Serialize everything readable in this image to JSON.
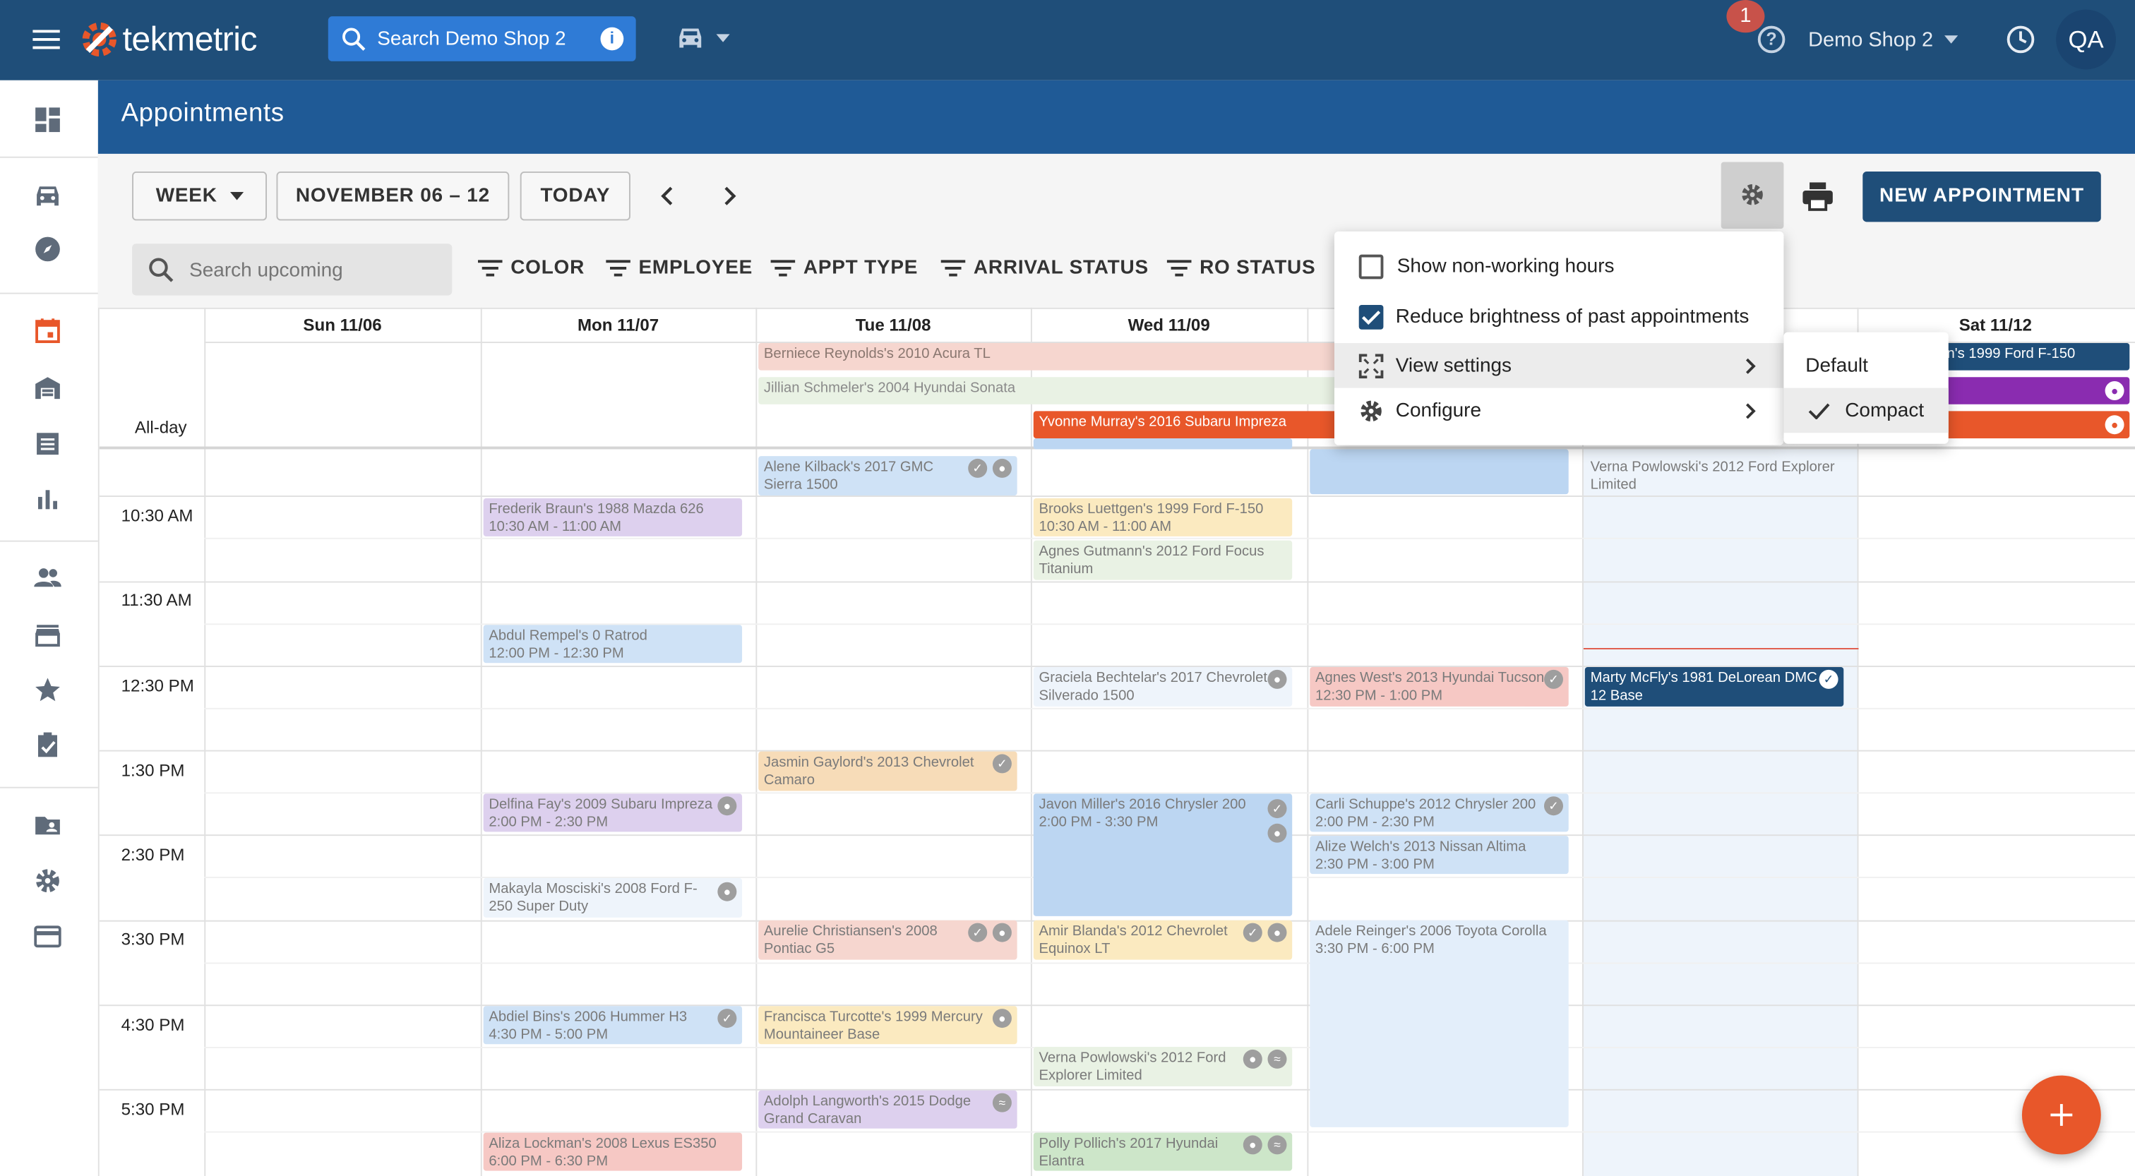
{
  "topbar": {
    "logo_text": "tekmetric",
    "search_label": "Search Demo Shop 2",
    "shop_name": "Demo Shop 2",
    "notification_count": "1",
    "user_initials": "QA"
  },
  "page": {
    "title": "Appointments"
  },
  "toolbar": {
    "view_label": "WEEK",
    "date_range": "NOVEMBER 06 – 12",
    "today_label": "TODAY",
    "new_appt_label": "NEW APPOINTMENT",
    "search_placeholder": "Search upcoming",
    "filters": [
      "COLOR",
      "EMPLOYEE",
      "APPT TYPE",
      "ARRIVAL STATUS",
      "RO STATUS"
    ]
  },
  "calendar": {
    "days": [
      "Sun 11/06",
      "Mon 11/07",
      "Tue 11/08",
      "Wed 11/09",
      "",
      "",
      "Sat 11/12"
    ],
    "allday_label": "All-day",
    "times": [
      "10:30 AM",
      "11:30 AM",
      "12:30 PM",
      "1:30 PM",
      "2:30 PM",
      "3:30 PM",
      "4:30 PM",
      "5:30 PM"
    ],
    "allday_events": {
      "e1": "Berniece Reynolds's 2010 Acura TL",
      "e2": "Jillian Schmeler's 2004 Hyundai Sonata",
      "e3": "Yvonne Murray's 2016 Subaru Impreza",
      "e4": "en's 1999 Ford F-150"
    },
    "events": {
      "alene": {
        "l1": "Alene Kilback's 2017 GMC",
        "l2": "Sierra 1500"
      },
      "verna_top": {
        "l1": "Verna Powlowski's 2012 Ford Explorer",
        "l2": "Limited"
      },
      "frederik": {
        "l1": "Frederik Braun's 1988 Mazda 626",
        "l2": "10:30 AM - 11:00 AM"
      },
      "brooks": {
        "l1": "Brooks Luettgen's 1999 Ford F-150",
        "l2": "10:30 AM - 11:00 AM"
      },
      "agnes_g": {
        "l1": "Agnes Gutmann's 2012 Ford Focus",
        "l2": "Titanium"
      },
      "abdul": {
        "l1": "Abdul Rempel's 0 Ratrod",
        "l2": "12:00 PM - 12:30 PM"
      },
      "graciela": {
        "l1": "Graciela Bechtelar's 2017 Chevrolet",
        "l2": "Silverado 1500"
      },
      "agnes_w": {
        "l1": "Agnes West's 2013 Hyundai Tucson",
        "l2": "12:30 PM - 1:00 PM"
      },
      "marty": {
        "l1": "Marty McFly's 1981 DeLorean DMC",
        "l2": "12 Base"
      },
      "jasmin": {
        "l1": "Jasmin Gaylord's 2013 Chevrolet",
        "l2": "Camaro"
      },
      "delfina": {
        "l1": "Delfina Fay's 2009 Subaru Impreza",
        "l2": "2:00 PM - 2:30 PM"
      },
      "javon": {
        "l1": "Javon Miller's 2016 Chrysler 200",
        "l2": "2:00 PM - 3:30 PM"
      },
      "carli": {
        "l1": "Carli Schuppe's 2012 Chrysler 200",
        "l2": "2:00 PM - 2:30 PM"
      },
      "alize": {
        "l1": "Alize Welch's 2013 Nissan Altima",
        "l2": "2:30 PM - 3:00 PM"
      },
      "makayla": {
        "l1": "Makayla Mosciski's 2008 Ford F-",
        "l2": "250 Super Duty"
      },
      "aurelie": {
        "l1": "Aurelie Christiansen's 2008",
        "l2": "Pontiac G5"
      },
      "amir": {
        "l1": "Amir Blanda's 2012 Chevrolet",
        "l2": "Equinox LT"
      },
      "adele": {
        "l1": "Adele Reinger's 2006 Toyota Corolla",
        "l2": "3:30 PM - 6:00 PM"
      },
      "abdiel": {
        "l1": "Abdiel Bins's 2006 Hummer H3",
        "l2": "4:30 PM - 5:00 PM"
      },
      "francisca": {
        "l1": "Francisca Turcotte's 1999 Mercury",
        "l2": "Mountaineer Base"
      },
      "verna_bot": {
        "l1": "Verna Powlowski's 2012 Ford",
        "l2": "Explorer Limited"
      },
      "adolph": {
        "l1": "Adolph Langworth's 2015 Dodge",
        "l2": "Grand Caravan"
      },
      "aliza": {
        "l1": "Aliza Lockman's 2008 Lexus ES350",
        "l2": "6:00 PM - 6:30 PM"
      },
      "polly": {
        "l1": "Polly Pollich's 2017 Hyundai",
        "l2": "Elantra"
      }
    }
  },
  "settings_menu": {
    "show_nonworking": "Show non-working hours",
    "show_nonworking_checked": false,
    "reduce_brightness": "Reduce brightness of past appointments",
    "reduce_brightness_checked": true,
    "view_settings": "View settings",
    "configure": "Configure"
  },
  "view_submenu": {
    "default": "Default",
    "compact": "Compact",
    "selected": "Compact"
  },
  "colors": {
    "topbar": "#1f4e79",
    "header": "#1f5a96",
    "accent": "#e8572a",
    "navy_button": "#1f4e79"
  }
}
